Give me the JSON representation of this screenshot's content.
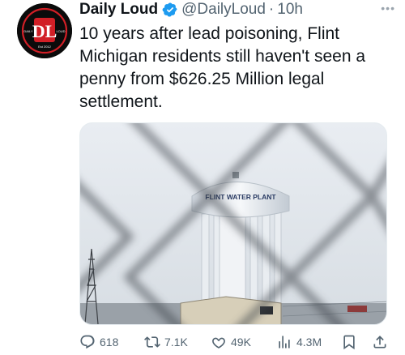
{
  "author": {
    "name": "Daily Loud",
    "handle": "@DailyLoud",
    "separator": "·",
    "time": "10h",
    "avatar_text": {
      "letters": "DL",
      "left": "DAILY",
      "right": "LOUD",
      "bottom": "Est 2012"
    }
  },
  "tweet": {
    "text": "10 years after lead poisoning, Flint\nMichigan residents still haven't seen a\npenny from $626.25 Million legal\nsettlement."
  },
  "media": {
    "tower_label": "FLINT WATER PLANT"
  },
  "actions": {
    "reply_count": "618",
    "retweet_count": "7.1K",
    "like_count": "49K",
    "view_count": "4.3M"
  },
  "colors": {
    "text": "#0f1419",
    "muted": "#536471",
    "verified": "#1d9bf0",
    "brand_red": "#d11f26"
  },
  "icons": [
    "more-icon",
    "verified-icon",
    "reply-icon",
    "retweet-icon",
    "like-icon",
    "views-icon",
    "bookmark-icon",
    "share-icon"
  ]
}
